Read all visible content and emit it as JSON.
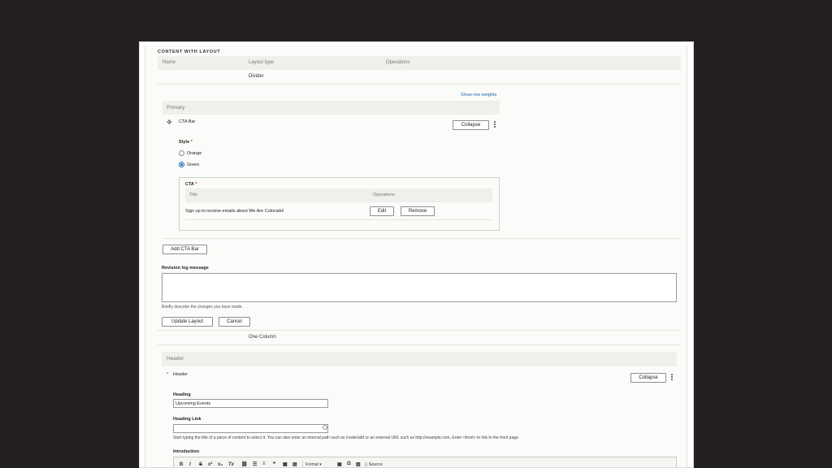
{
  "section": {
    "title": "CONTENT WITH LAYOUT"
  },
  "table": {
    "col_name": "Name",
    "col_layout_type": "Layout type",
    "col_operations": "Operations"
  },
  "rows": {
    "divider": "Divider",
    "one_column": "One Column"
  },
  "show_row_weights": "Show row weights",
  "primary": {
    "region_label": "Primary",
    "item_label": "CTA Bar",
    "collapse_label": "Collapse",
    "style_label": "Style",
    "required_mark": "*",
    "style_options": [
      "Orange",
      "Green"
    ],
    "style_selected": "Green",
    "cta": {
      "label": "CTA",
      "col_title": "Title",
      "col_operations": "Operations",
      "row_title": "Sign up to receive emails about We Are Colorado!",
      "edit_label": "Edit",
      "remove_label": "Remove"
    },
    "add_button": "Add CTA Bar"
  },
  "revision": {
    "label": "Revision log message",
    "value": "",
    "help": "Briefly describe the changes you have made."
  },
  "actions": {
    "update": "Update Layout",
    "cancel": "Cancel"
  },
  "header_region": {
    "region_label": "Header",
    "item_label": "Header",
    "collapse_label": "Collapse",
    "heading_label": "Heading",
    "heading_value": "Upcoming Events",
    "heading_link_label": "Heading Link",
    "heading_link_value": "",
    "heading_link_help": "Start typing the title of a piece of content to select it. You can also enter an internal path such as /node/add or an external URL such as http://example.com. Enter <front> to link to the front page.",
    "intro_label": "Introduction"
  },
  "toolbar": {
    "bold": "B",
    "italic": "I",
    "strike": "S",
    "superscript": "x²",
    "subscript": "x₂",
    "clear": "Tx",
    "format": "Format",
    "omega": "Ω",
    "source": "Source"
  }
}
